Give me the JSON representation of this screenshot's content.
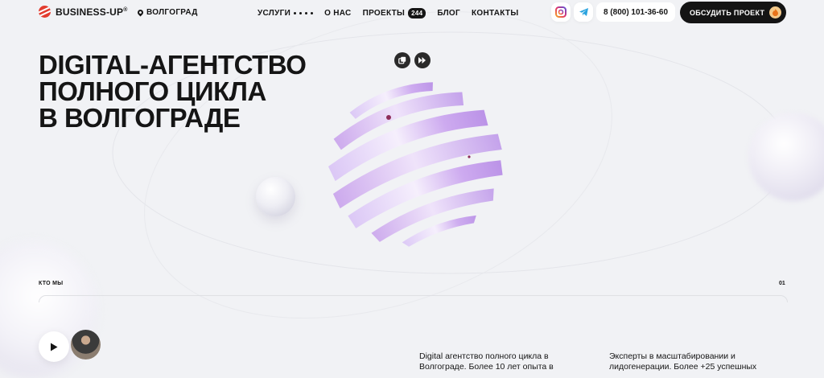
{
  "header": {
    "logo": "BUSINESS-UP",
    "logo_mark": "®",
    "city": "ВОЛГОГРАД",
    "nav": [
      {
        "label": "УСЛУГИ"
      },
      {
        "label": "О НАС"
      },
      {
        "label": "ПРОЕКТЫ",
        "badge": "244"
      },
      {
        "label": "БЛОГ"
      },
      {
        "label": "КОНТАКТЫ"
      }
    ],
    "phone": "8 (800) 101-36-60",
    "cta_label": "ОБСУДИТЬ ПРОЕКТ",
    "icons": [
      "location-pin-icon",
      "grid-dots-icon",
      "instagram-icon",
      "telegram-icon",
      "fire-icon"
    ]
  },
  "hero": {
    "title_lines": [
      "DIGITAL-АГЕНТСТВО",
      "ПОЛНОГО ЦИКЛА",
      "В ВОЛГОГРАДЕ"
    ]
  },
  "about": {
    "label": "КТО МЫ",
    "number": "01",
    "text1": "Digital агентство полного цикла в Волгограде. Более 10 лет опыта в",
    "text2": "Эксперты в масштабировании и лидогенерации. Более +25 успешных"
  },
  "colors": {
    "background": "#f1f2f5",
    "text": "#151515",
    "accent_red": "#e23b2e",
    "sphere": "#c9a3ec"
  }
}
